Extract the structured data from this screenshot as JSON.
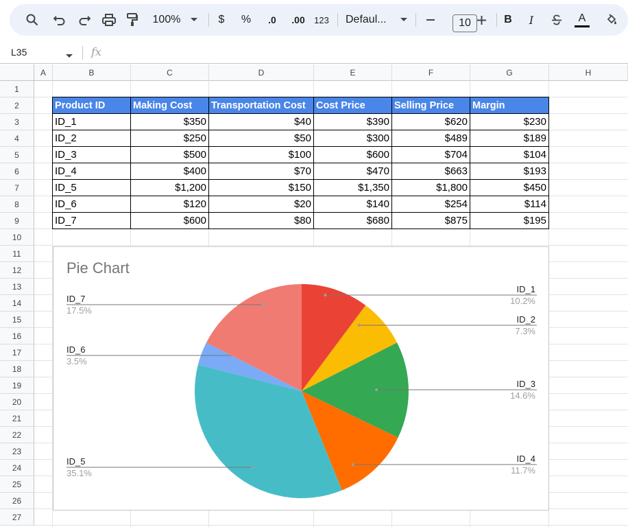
{
  "toolbar": {
    "zoom": "100%",
    "currency": "$",
    "percent": "%",
    "dec_decrease": ".0",
    "dec_increase": ".00",
    "number_format": "123",
    "font": "Defaul...",
    "font_size": "10",
    "bold": "B",
    "italic": "I",
    "text_color_letter": "A",
    "icons": [
      "search-icon",
      "undo-icon",
      "redo-icon",
      "print-icon",
      "paint-format-icon",
      "minus-icon",
      "plus-icon",
      "strikethrough-icon",
      "fill-color-icon"
    ]
  },
  "formula_bar": {
    "name_box": "L35",
    "fx": "fx"
  },
  "columns": [
    "A",
    "B",
    "C",
    "D",
    "E",
    "F",
    "G",
    "H"
  ],
  "rows": [
    "1",
    "2",
    "3",
    "4",
    "5",
    "6",
    "7",
    "8",
    "9",
    "10",
    "11",
    "12",
    "13",
    "14",
    "15",
    "16",
    "17",
    "18",
    "19",
    "20",
    "21",
    "22",
    "23",
    "24",
    "25",
    "26",
    "27"
  ],
  "table": {
    "headers": [
      "Product ID",
      "Making Cost",
      "Transportation Cost",
      "Cost Price",
      "Selling Price",
      "Margin"
    ],
    "rows": [
      [
        "ID_1",
        "$350",
        "$40",
        "$390",
        "$620",
        "$230"
      ],
      [
        "ID_2",
        "$250",
        "$50",
        "$300",
        "$489",
        "$189"
      ],
      [
        "ID_3",
        "$500",
        "$100",
        "$600",
        "$704",
        "$104"
      ],
      [
        "ID_4",
        "$400",
        "$70",
        "$470",
        "$663",
        "$193"
      ],
      [
        "ID_5",
        "$1,200",
        "$150",
        "$1,350",
        "$1,800",
        "$450"
      ],
      [
        "ID_6",
        "$120",
        "$20",
        "$140",
        "$254",
        "$114"
      ],
      [
        "ID_7",
        "$600",
        "$80",
        "$680",
        "$875",
        "$195"
      ]
    ]
  },
  "colors": {
    "header_bg": "#4a86e8",
    "toolbar_bg": "#edf2fa"
  },
  "chart_data": {
    "type": "pie",
    "title": "Pie Chart",
    "slices": [
      {
        "label": "ID_1",
        "value": 10.2,
        "display": "10.2%",
        "color": "#ea4335"
      },
      {
        "label": "ID_2",
        "value": 7.3,
        "display": "7.3%",
        "color": "#fbbc04"
      },
      {
        "label": "ID_3",
        "value": 14.6,
        "display": "14.6%",
        "color": "#34a853"
      },
      {
        "label": "ID_4",
        "value": 11.7,
        "display": "11.7%",
        "color": "#ff6d01"
      },
      {
        "label": "ID_5",
        "value": 35.1,
        "display": "35.1%",
        "color": "#46bdc6"
      },
      {
        "label": "ID_6",
        "value": 3.5,
        "display": "3.5%",
        "color": "#7baaf7"
      },
      {
        "label": "ID_7",
        "value": 17.5,
        "display": "17.5%",
        "color": "#f07b72"
      }
    ]
  }
}
